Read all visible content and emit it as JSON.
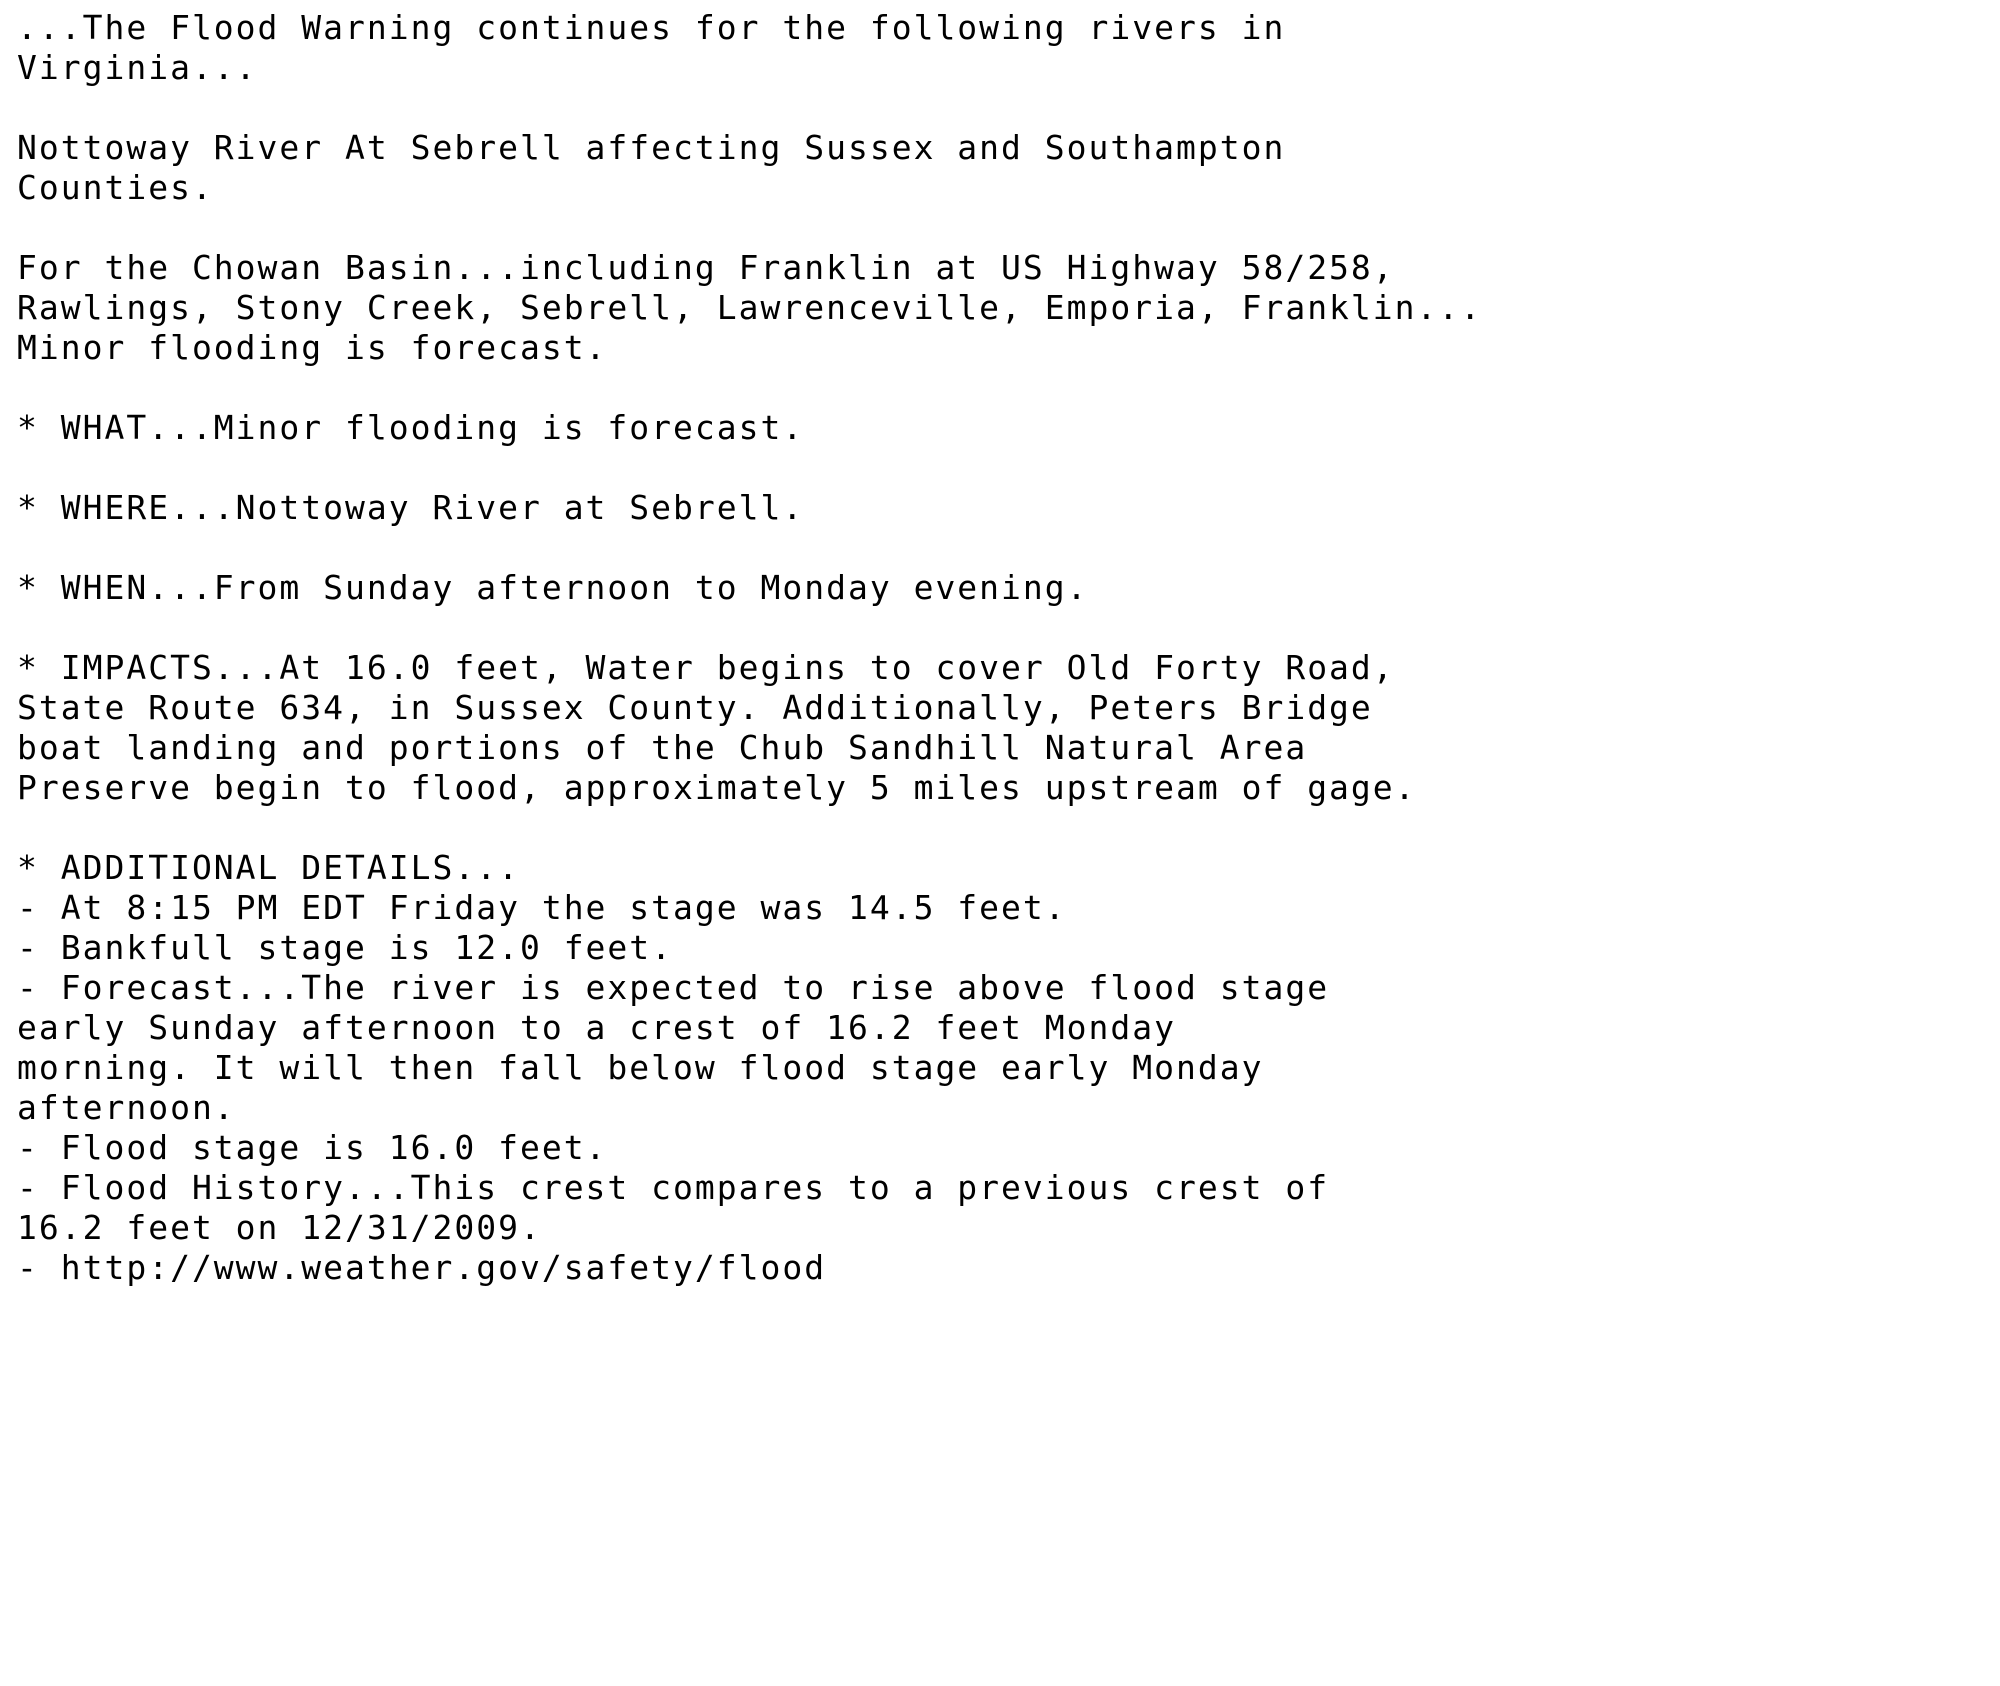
{
  "document": {
    "type": "nws-flood-warning-statement",
    "background_color": "#ffffff",
    "text_color": "#000000",
    "lines": [
      "...The Flood Warning continues for the following rivers in",
      "Virginia...",
      "",
      "Nottoway River At Sebrell affecting Sussex and Southampton",
      "Counties.",
      "",
      "For the Chowan Basin...including Franklin at US Highway 58/258,",
      "Rawlings, Stony Creek, Sebrell, Lawrenceville, Emporia, Franklin...",
      "Minor flooding is forecast.",
      "",
      "* WHAT...Minor flooding is forecast.",
      "",
      "* WHERE...Nottoway River at Sebrell.",
      "",
      "* WHEN...From Sunday afternoon to Monday evening.",
      "",
      "* IMPACTS...At 16.0 feet, Water begins to cover Old Forty Road,",
      "State Route 634, in Sussex County. Additionally, Peters Bridge",
      "boat landing and portions of the Chub Sandhill Natural Area",
      "Preserve begin to flood, approximately 5 miles upstream of gage.",
      "",
      "* ADDITIONAL DETAILS...",
      "- At 8:15 PM EDT Friday the stage was 14.5 feet.",
      "- Bankfull stage is 12.0 feet.",
      "- Forecast...The river is expected to rise above flood stage",
      "early Sunday afternoon to a crest of 16.2 feet Monday",
      "morning. It will then fall below flood stage early Monday",
      "afternoon.",
      "- Flood stage is 16.0 feet.",
      "- Flood History...This crest compares to a previous crest of",
      "16.2 feet on 12/31/2009.",
      "- http://www.weather.gov/safety/flood"
    ],
    "key_values": {
      "headline": "...The Flood Warning continues for the following rivers in Virginia...",
      "river_location": "Nottoway River At Sebrell",
      "affected_counties": "Sussex and Southampton Counties",
      "basin": "Chowan Basin",
      "what": "Minor flooding is forecast.",
      "where": "Nottoway River at Sebrell.",
      "when": "From Sunday afternoon to Monday evening.",
      "impact_stage_feet": "16.0",
      "impact_road": "Old Forty Road, State Route 634, in Sussex County",
      "impact_additional": "Peters Bridge boat landing and portions of the Chub Sandhill Natural Area Preserve",
      "impact_distance": "approximately 5 miles upstream of gage",
      "observation_time": "8:15 PM EDT Friday",
      "observed_stage_feet": "14.5",
      "bankfull_stage_feet": "12.0",
      "flood_stage_feet": "16.0",
      "forecast_crest_feet": "16.2",
      "forecast_crest_time": "Monday morning",
      "previous_crest_feet": "16.2",
      "previous_crest_date": "12/31/2009",
      "safety_url": "http://www.weather.gov/safety/flood"
    }
  }
}
